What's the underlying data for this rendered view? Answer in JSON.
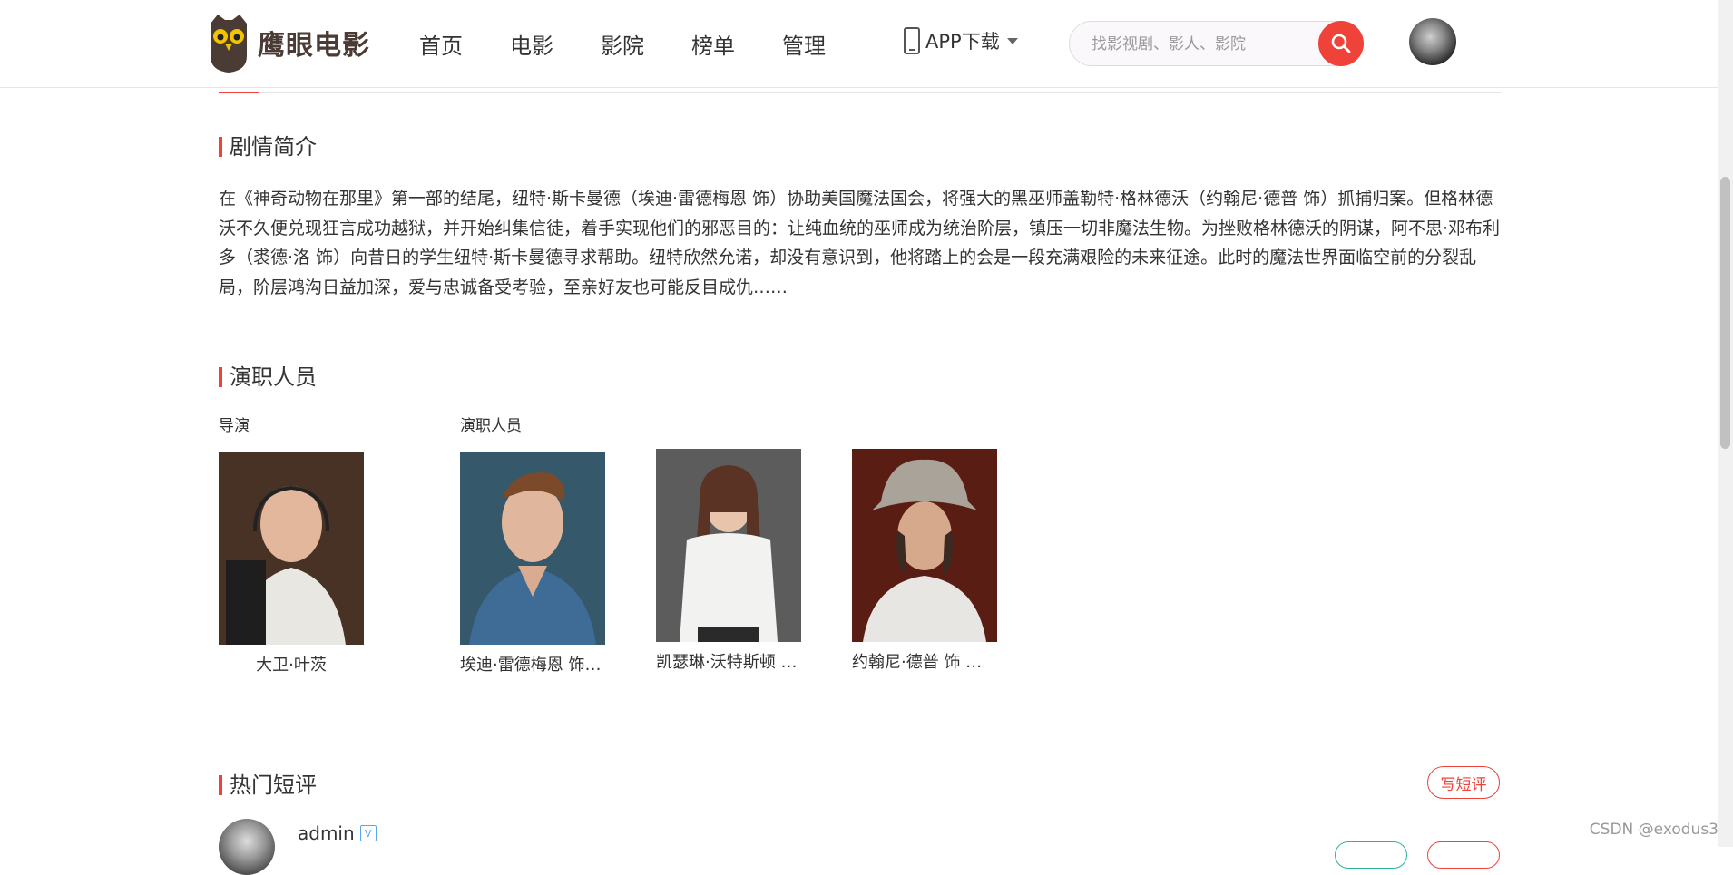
{
  "header": {
    "logo_text": "鹰眼电影",
    "nav": [
      "首页",
      "电影",
      "影院",
      "榜单",
      "管理"
    ],
    "app_download": "APP下载",
    "search_placeholder": "找影视剧、影人、影院"
  },
  "synopsis": {
    "title": "剧情简介",
    "text": "在《神奇动物在那里》第一部的结尾，纽特·斯卡曼德（埃迪·雷德梅恩 饰）协助美国魔法国会，将强大的黑巫师盖勒特·格林德沃（约翰尼·德普 饰）抓捕归案。但格林德沃不久便兑现狂言成功越狱，并开始纠集信徒，着手实现他们的邪恶目的：让纯血统的巫师成为统治阶层，镇压一切非魔法生物。为挫败格林德沃的阴谋，阿不思·邓布利多（裘德·洛 饰）向昔日的学生纽特·斯卡曼德寻求帮助。纽特欣然允诺，却没有意识到，他将踏上的会是一段充满艰险的未来征途。此时的魔法世界面临空前的分裂乱局，阶层鸿沟日益加深，爱与忠诚备受考验，至亲好友也可能反目成仇……"
  },
  "cast": {
    "title": "演职人员",
    "director_label": "导演",
    "actors_label": "演职人员",
    "director": {
      "name": "大卫·叶茨"
    },
    "actors": [
      {
        "name": "埃迪·雷德梅恩 饰 纽特·斯卡曼德"
      },
      {
        "name": "凯瑟琳·沃特斯顿 饰 蒂娜"
      },
      {
        "name": "约翰尼·德普 饰 盖勒特·格林德沃"
      }
    ]
  },
  "reviews": {
    "title": "热门短评",
    "write_button": "写短评",
    "first_user": "admin",
    "badge": "V"
  },
  "watermark": "CSDN @exodus3",
  "colors": {
    "accent": "#ef4238",
    "text": "#333333"
  }
}
